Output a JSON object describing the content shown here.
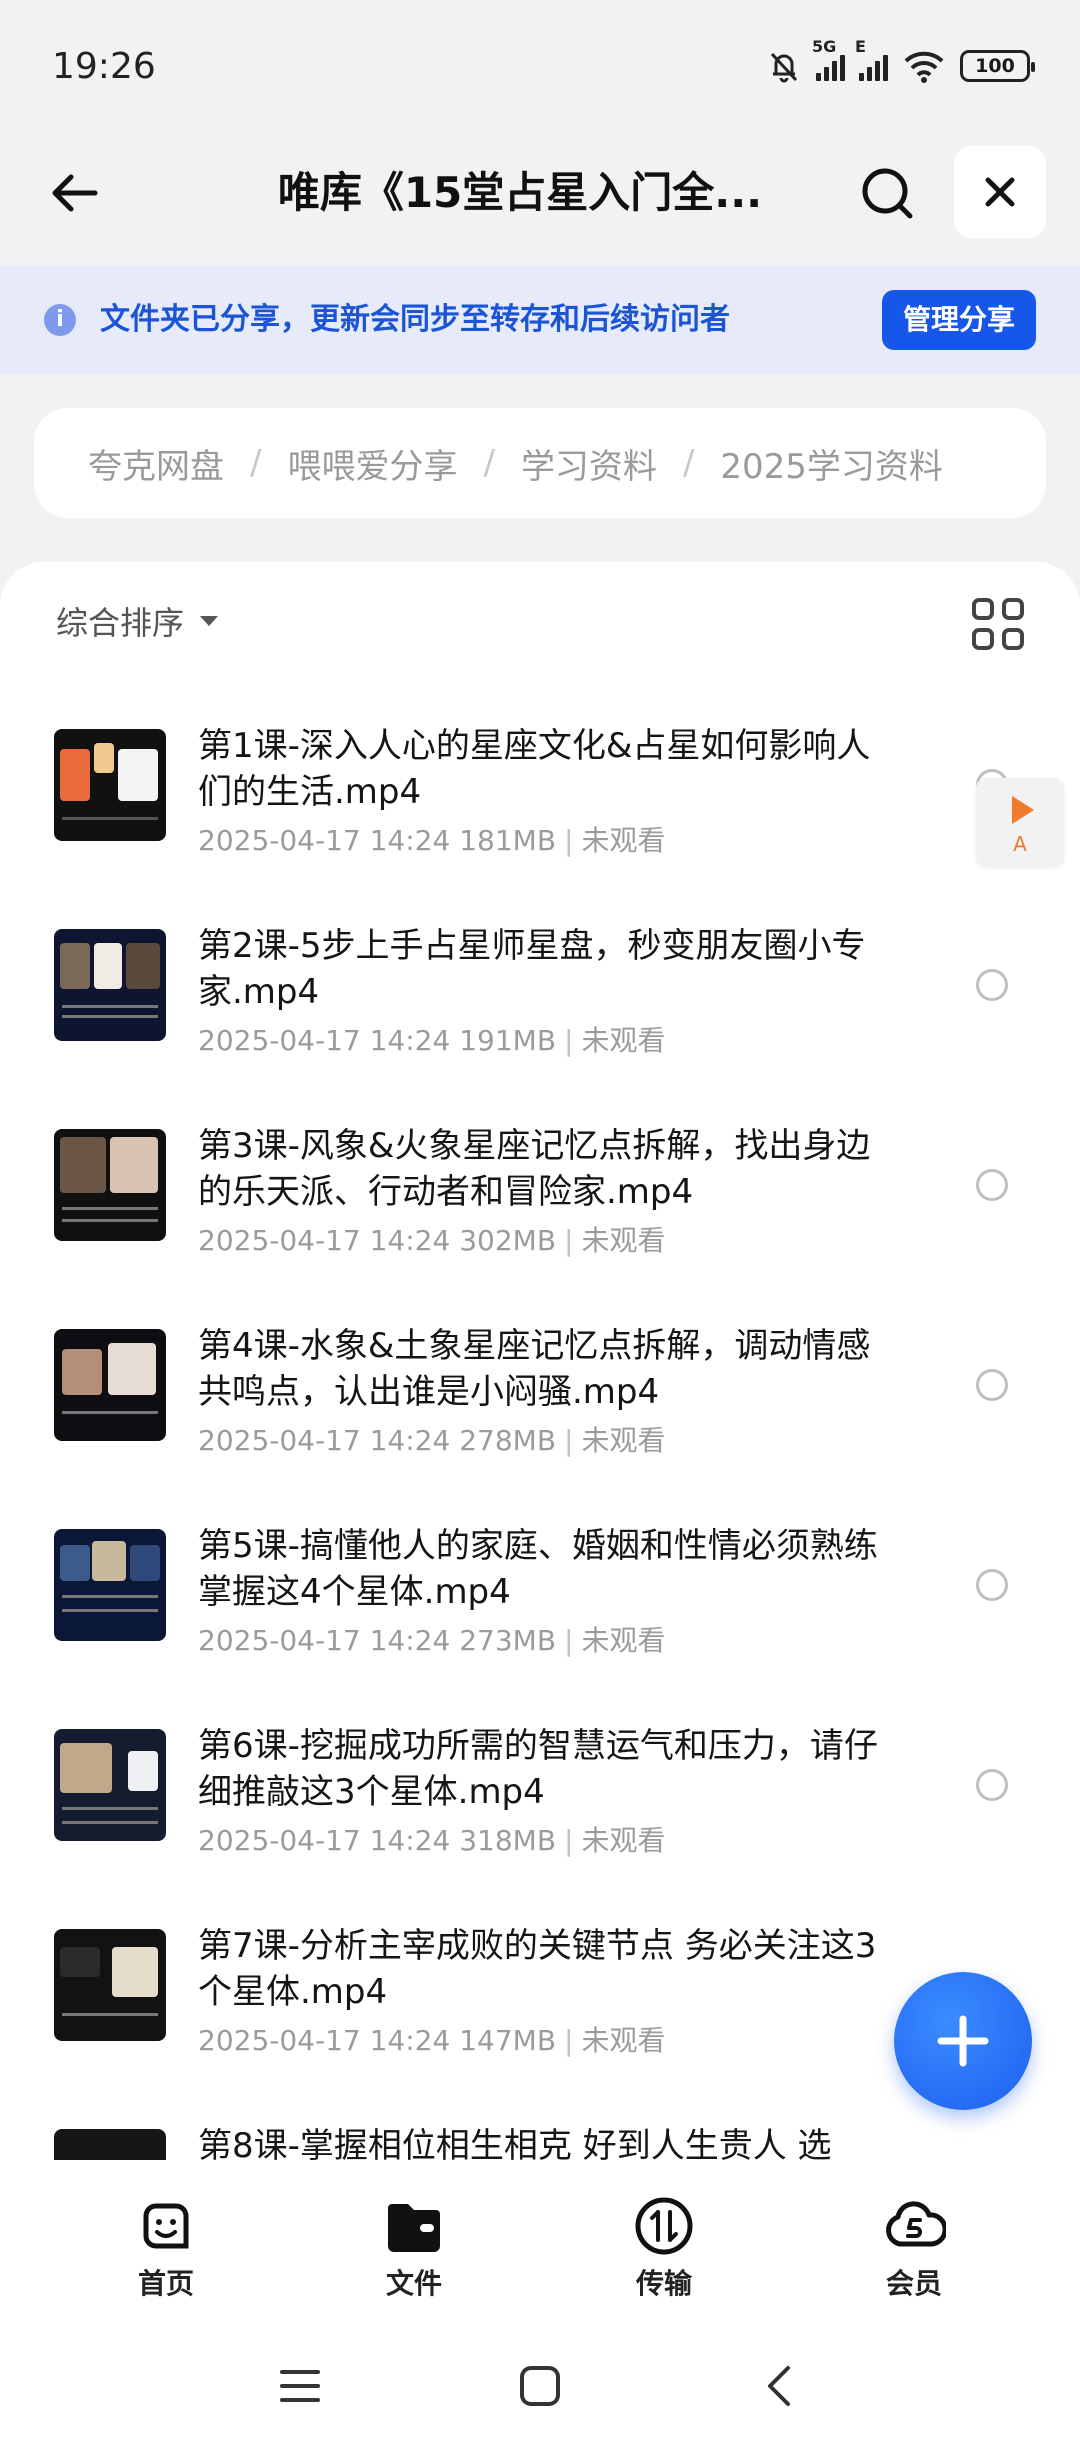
{
  "status_bar": {
    "time": "19:26",
    "network_1": "5G",
    "network_2": "E",
    "battery": "100"
  },
  "header": {
    "title": "唯库《15堂占星入门全...",
    "icons": [
      "back-arrow-icon",
      "search-icon",
      "close-icon"
    ]
  },
  "banner": {
    "text": "文件夹已分享，更新会同步至转存和后续访问者",
    "manage_label": "管理分享",
    "accent": "#1656e8"
  },
  "breadcrumb": [
    "夸克网盘",
    "喂喂爱分享",
    "学习资料",
    "2025学习资料"
  ],
  "sort": {
    "label": "综合排序"
  },
  "files": [
    {
      "name": "第1课-深入人心的星座文化&占星如何影响人们的生活.mp4",
      "date": "2025-04-17 14:24",
      "size": "181MB",
      "status": "未观看"
    },
    {
      "name": "第2课-5步上手占星师星盘，秒变朋友圈小专家.mp4",
      "date": "2025-04-17 14:24",
      "size": "191MB",
      "status": "未观看"
    },
    {
      "name": "第3课-风象&火象星座记忆点拆解，找出身边的乐天派、行动者和冒险家.mp4",
      "date": "2025-04-17 14:24",
      "size": "302MB",
      "status": "未观看"
    },
    {
      "name": "第4课-水象&土象星座记忆点拆解，调动情感共鸣点，认出谁是小闷骚.mp4",
      "date": "2025-04-17 14:24",
      "size": "278MB",
      "status": "未观看"
    },
    {
      "name": "第5课-搞懂他人的家庭、婚姻和性情必须熟练掌握这4个星体.mp4",
      "date": "2025-04-17 14:24",
      "size": "273MB",
      "status": "未观看"
    },
    {
      "name": "第6课-挖掘成功所需的智慧运气和压力，请仔细推敲这3个星体.mp4",
      "date": "2025-04-17 14:24",
      "size": "318MB",
      "status": "未观看"
    },
    {
      "name": "第7课-分析主宰成败的关键节点 务必关注这3个星体.mp4",
      "date": "2025-04-17 14:24",
      "size": "147MB",
      "status": "未观看"
    },
    {
      "name": "第8课-掌握相位相生相克 好到人生贵人 选",
      "date": "",
      "size": "",
      "status": ""
    }
  ],
  "floating_button": {
    "label": "A"
  },
  "tabs": [
    {
      "label": "首页",
      "icon": "smile-home-icon"
    },
    {
      "label": "文件",
      "icon": "folder-icon"
    },
    {
      "label": "传输",
      "icon": "transfer-icon"
    },
    {
      "label": "会员",
      "icon": "vip-icon"
    }
  ],
  "system_nav": [
    "menu-icon",
    "home-square-icon",
    "back-chevron-icon"
  ]
}
